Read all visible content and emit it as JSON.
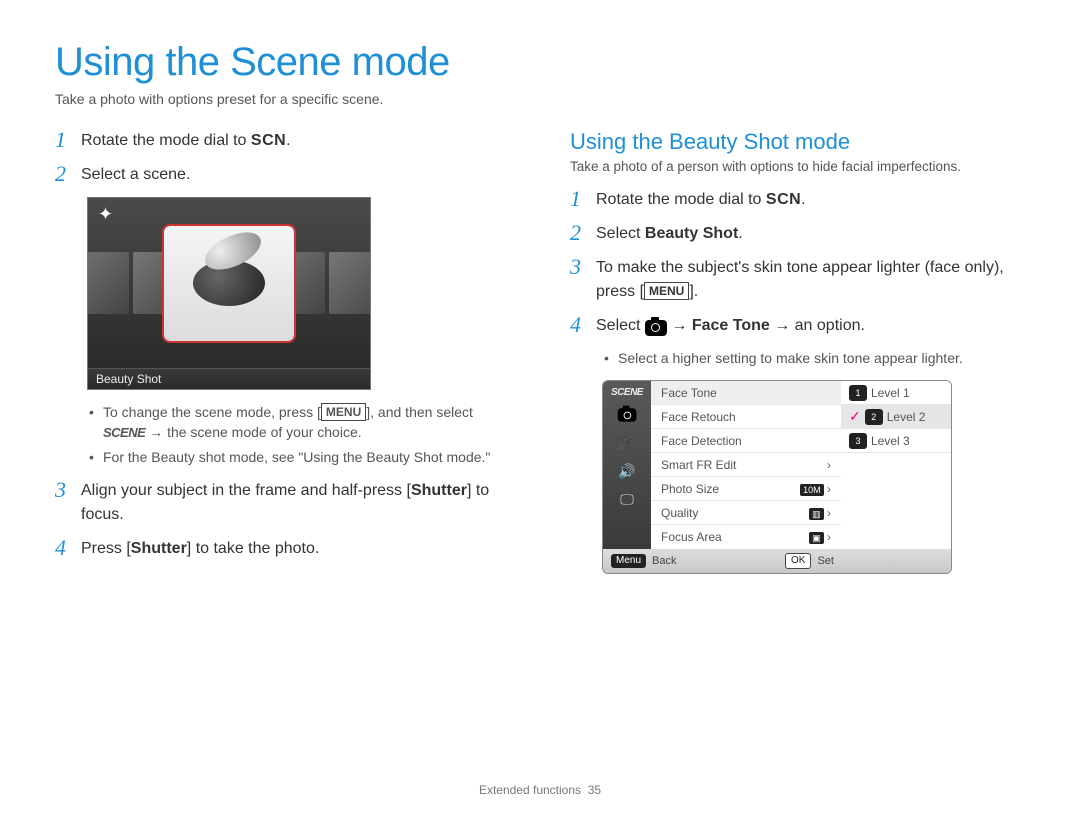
{
  "title": "Using the Scene mode",
  "subtitle": "Take a photo with options preset for a specific scene.",
  "scn": "SCN",
  "scene_word": "SCENE",
  "menu_label": "MENU",
  "left": {
    "steps": {
      "s1": {
        "num": "1",
        "text": "Rotate the mode dial to "
      },
      "s2": {
        "num": "2",
        "text": "Select a scene."
      },
      "s3": {
        "num": "3",
        "a": "Align your subject in the frame and half-press [",
        "shutter": "Shutter",
        "b": "] to focus."
      },
      "s4": {
        "num": "4",
        "a": "Press [",
        "shutter": "Shutter",
        "b": "] to take the photo."
      }
    },
    "figure_caption": "Beauty Shot",
    "bullets": {
      "b1a": "To change the scene mode, press [",
      "b1b": "], and then select ",
      "b1c": " → the scene mode of your choice.",
      "b2": "For the Beauty shot mode, see \"Using the Beauty Shot mode.\""
    }
  },
  "right": {
    "heading": "Using the Beauty Shot mode",
    "sub": "Take a photo of a person with options to hide facial imperfections.",
    "steps": {
      "s1": {
        "num": "1",
        "text": "Rotate the mode dial to "
      },
      "s2": {
        "num": "2",
        "a": "Select ",
        "bold": "Beauty Shot",
        "b": "."
      },
      "s3": {
        "num": "3",
        "a": "To make the subject's skin tone appear lighter (face only), press [",
        "b": "]."
      },
      "s4": {
        "num": "4",
        "a": "Select ",
        "arrow": " → ",
        "bold": "Face Tone",
        "b": " → an option."
      }
    },
    "bullet": "Select a higher setting to make skin tone appear lighter.",
    "menu": {
      "left_items": [
        "Face Tone",
        "Face Retouch",
        "Face Detection",
        "Smart FR Edit",
        "Photo Size",
        "Quality",
        "Focus Area"
      ],
      "right_items": [
        "Level 1",
        "Level 2",
        "Level 3"
      ],
      "selected_left": 0,
      "selected_right": 1,
      "size_label": "10M",
      "footer_back": "Back",
      "footer_set": "Set",
      "footer_back_btn": "Menu",
      "footer_set_btn": "OK"
    }
  },
  "footer": {
    "label": "Extended functions",
    "page": "35"
  }
}
